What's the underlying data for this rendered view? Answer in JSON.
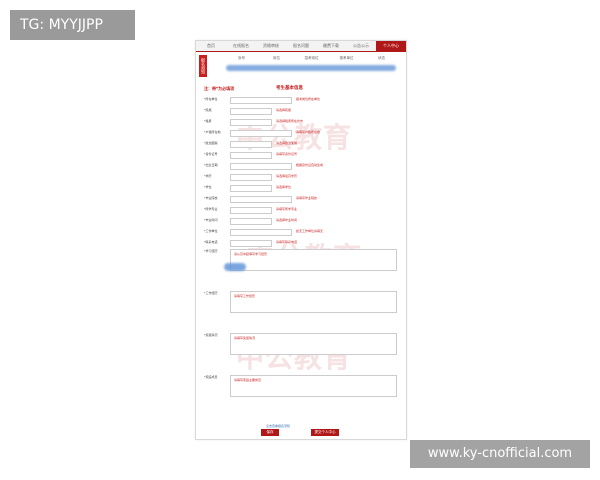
{
  "tag": "TG: MYYJJPP",
  "site": "www.ky-cnofficial.com",
  "nav": [
    "首页",
    "在线报名",
    "资格审核",
    "报名问题",
    "缴费下载",
    "公告公示",
    "个人中心"
  ],
  "nav_active_index": 6,
  "side_tab": "报名须知",
  "table_head": [
    "序号",
    "岗位",
    "招考岗位",
    "报考单位",
    "状态"
  ],
  "required_note": "注：带*为必填项",
  "form_title": "考生基本信息",
  "watermark": "中公教育",
  "fields": [
    {
      "label": "*所在单位",
      "tip": "报考岗位所在单位"
    },
    {
      "label": "*民族",
      "tip": "请选择民族"
    },
    {
      "label": "*籍贯",
      "tip": "请选择籍贯所在省市"
    },
    {
      "label": "*户籍所在地",
      "tip": "请填写户籍所在地"
    },
    {
      "label": "*政治面貌",
      "tip": "请选择政治面貌"
    },
    {
      "label": "*身份证号",
      "tip": "请填写身份证号"
    },
    {
      "label": "*出生日期",
      "tip": "根据身份证自动生成"
    },
    {
      "label": "*学历",
      "tip": "请选择最高学历"
    },
    {
      "label": "*学位",
      "tip": "请选择学位"
    },
    {
      "label": "*毕业院校",
      "tip": "请填写毕业院校"
    },
    {
      "label": "*所学专业",
      "tip": "请填写所学专业"
    },
    {
      "label": "*毕业时间",
      "tip": "请选择毕业时间"
    },
    {
      "label": "*工作单位",
      "tip": "如无工作单位请填无"
    },
    {
      "label": "*联系电话",
      "tip": "请填写联系电话"
    }
  ],
  "textareas": [
    {
      "label": "*学习经历",
      "tip": "请从高中起填写学习经历"
    },
    {
      "label": "*工作经历",
      "tip": "请填写工作经历"
    },
    {
      "label": "*奖惩情况",
      "tip": "请填写奖惩情况"
    },
    {
      "label": "*家庭成员",
      "tip": "请填写家庭主要成员"
    }
  ],
  "footer_link": "点击查看报名须知",
  "buttons": {
    "save": "保存",
    "submit": "提交个人中心"
  }
}
